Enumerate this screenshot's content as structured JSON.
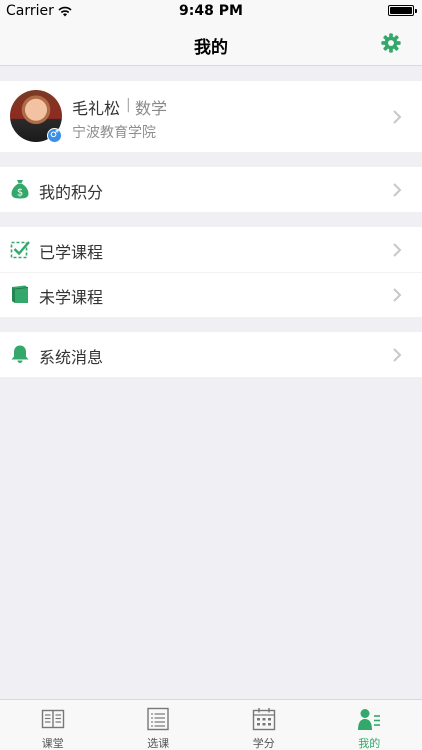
{
  "status_bar": {
    "carrier": "Carrier",
    "time": "9:48 PM"
  },
  "nav": {
    "title": "我的"
  },
  "profile": {
    "name": "毛礼松",
    "separator": "|",
    "subject": "数学",
    "school": "宁波教育学院",
    "gender_symbol": "♂"
  },
  "menu": {
    "points": "我的积分",
    "learned": "已学课程",
    "unlearned": "未学课程",
    "messages": "系统消息"
  },
  "tabs": [
    {
      "label": "课堂",
      "icon": "book-open-icon"
    },
    {
      "label": "选课",
      "icon": "list-icon"
    },
    {
      "label": "学分",
      "icon": "calendar-icon"
    },
    {
      "label": "我的",
      "icon": "person-icon"
    }
  ],
  "colors": {
    "accent": "#33a86a",
    "background": "#efeff4"
  }
}
